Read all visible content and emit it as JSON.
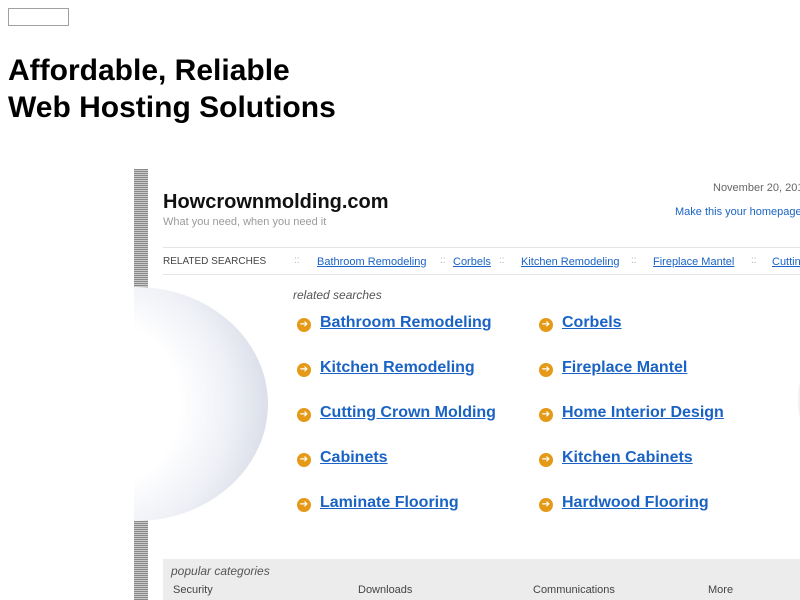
{
  "headline": {
    "line1": "Affordable, Reliable",
    "line2": "Web Hosting Solutions"
  },
  "site": {
    "title": "Howcrownmolding.com",
    "tagline": "What you need, when you need it",
    "date": "November 20, 201",
    "homepage_link": "Make this your homepage"
  },
  "related_bar": {
    "label": "RELATED SEARCHES",
    "separator": "::",
    "links": [
      "Bathroom Remodeling",
      "Corbels",
      "Kitchen Remodeling",
      "Fireplace Mantel",
      "Cuttin"
    ]
  },
  "related": {
    "title": "related searches",
    "arrow_glyph": "➔",
    "left": [
      "Bathroom Remodeling",
      "Kitchen Remodeling",
      "Cutting Crown Molding",
      "Cabinets",
      "Laminate Flooring"
    ],
    "right": [
      "Corbels",
      "Fireplace Mantel",
      "Home Interior Design",
      "Kitchen Cabinets",
      "Hardwood Flooring"
    ]
  },
  "popular": {
    "title": "popular categories",
    "categories": [
      "Security",
      "Downloads",
      "Communications",
      "More"
    ]
  },
  "colors": {
    "link": "#1a63c4",
    "arrow": "#e59a17"
  },
  "icons": {
    "arrow": "arrow-right-circle-icon"
  }
}
